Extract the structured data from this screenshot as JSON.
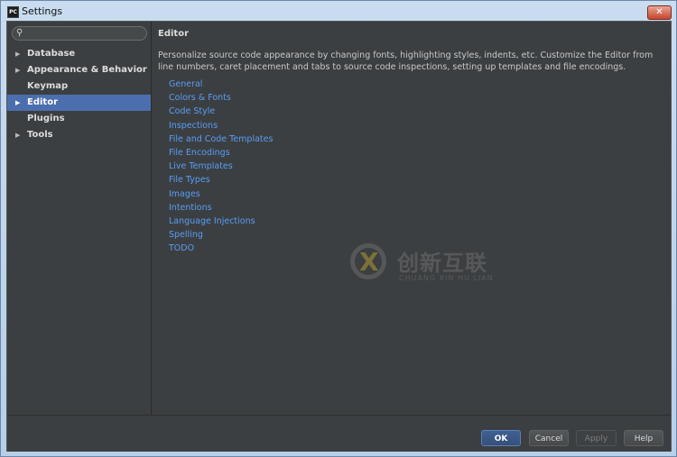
{
  "window": {
    "title": "Settings",
    "app_icon_text": "PC",
    "close_symbol": "✕"
  },
  "search": {
    "placeholder": ""
  },
  "sidebar": {
    "items": [
      {
        "label": "Database",
        "arrow": "▶"
      },
      {
        "label": "Appearance & Behavior",
        "arrow": "▶"
      },
      {
        "label": "Keymap",
        "arrow": ""
      },
      {
        "label": "Editor",
        "arrow": "▶",
        "selected": true
      },
      {
        "label": "Plugins",
        "arrow": ""
      },
      {
        "label": "Tools",
        "arrow": "▶"
      }
    ]
  },
  "main": {
    "heading": "Editor",
    "description": "Personalize source code appearance by changing fonts, highlighting styles, indents, etc. Customize the Editor from line numbers, caret placement and tabs to source code inspections, setting up templates and file encodings.",
    "links": [
      "General",
      "Colors & Fonts",
      "Code Style",
      "Inspections",
      "File and Code Templates",
      "File Encodings",
      "Live Templates",
      "File Types",
      "Images",
      "Intentions",
      "Language Injections",
      "Spelling",
      "TODO"
    ]
  },
  "watermark": {
    "cn": "创新互联",
    "en": "CHUANG XIN HU LIAN",
    "mark": "X"
  },
  "footer": {
    "ok": "OK",
    "cancel": "Cancel",
    "apply": "Apply",
    "help": "Help"
  },
  "colors": {
    "accent": "#4b6eaf",
    "link": "#589df6",
    "panel": "#3c3f41"
  }
}
